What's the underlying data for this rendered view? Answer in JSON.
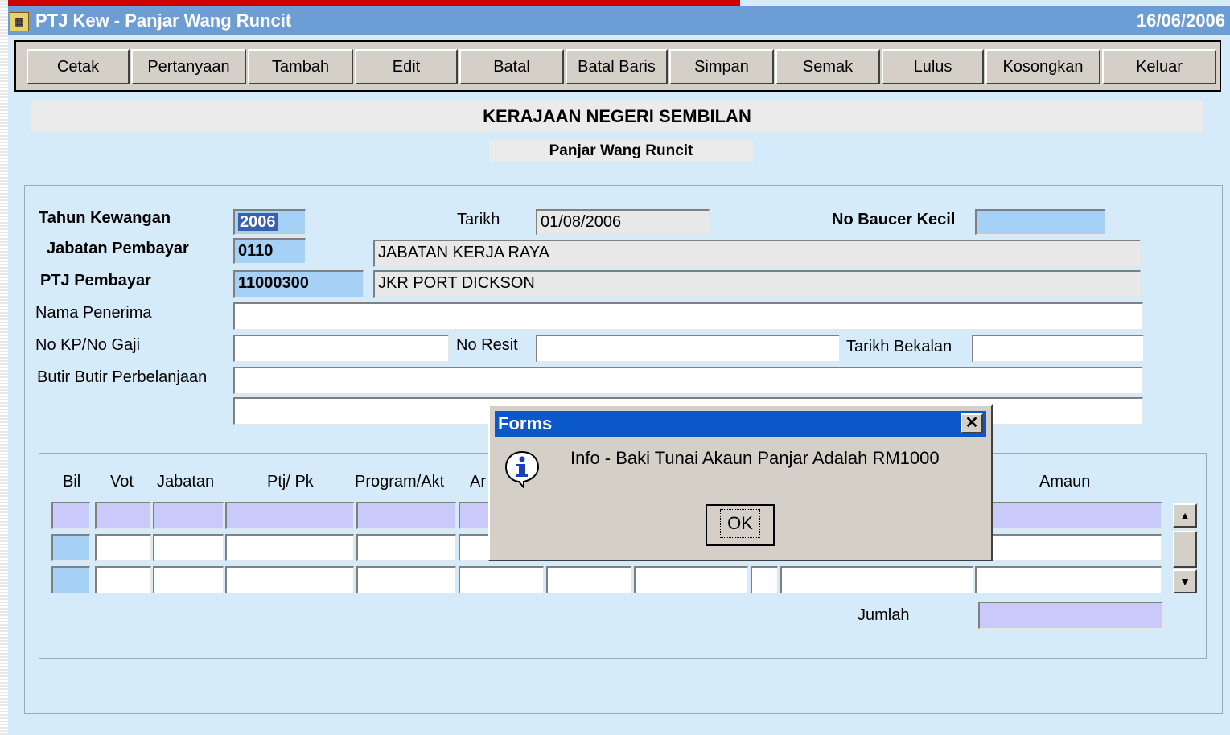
{
  "window": {
    "title": "PTJ Kew - Panjar Wang Runcit",
    "date": "16/06/2006"
  },
  "toolbar": {
    "buttons": [
      "Cetak",
      "Pertanyaan",
      "Tambah",
      "Edit",
      "Batal",
      "Batal Baris",
      "Simpan",
      "Semak",
      "Lulus",
      "Kosongkan",
      "Keluar"
    ]
  },
  "header": {
    "org": "KERAJAAN NEGERI SEMBILAN",
    "form": "Panjar Wang Runcit"
  },
  "form": {
    "tahun_label": "Tahun Kewangan",
    "tahun_value": "2006",
    "tarikh_label": "Tarikh",
    "tarikh_value": "01/08/2006",
    "baucer_label": "No Baucer Kecil",
    "baucer_value": "",
    "jabatan_label": "Jabatan Pembayar",
    "jabatan_code": "0110",
    "jabatan_name": "JABATAN KERJA RAYA",
    "ptj_label": "PTJ Pembayar",
    "ptj_code": "11000300",
    "ptj_name": "JKR PORT DICKSON",
    "penerima_label": "Nama Penerima",
    "penerima_value": "",
    "kp_label": "No KP/No Gaji",
    "kp_value": "",
    "resit_label": "No Resit",
    "resit_value": "",
    "bekalan_label": "Tarikh Bekalan",
    "bekalan_value": "",
    "butir_label": "Butir Butir Perbelanjaan",
    "butir_value1": "",
    "butir_value2": ""
  },
  "grid": {
    "columns": {
      "bil": "Bil",
      "vot": "Vot",
      "jabatan": "Jabatan",
      "ptj": "Ptj/ Pk",
      "program": "Program/Akt",
      "amanah_partial": "Ar",
      "amaun": "Amaun"
    },
    "jumlah_label": "Jumlah",
    "jumlah_value": ""
  },
  "dialog": {
    "title": "Forms",
    "message": "Info - Baki Tunai Akaun Panjar Adalah RM1000",
    "ok_label": "OK",
    "close_glyph": "✕"
  },
  "scroll": {
    "up": "▲",
    "down": "▼"
  },
  "icons": {
    "app": "forms-app-icon",
    "info": "info-icon"
  },
  "colors": {
    "title_bar": "#6c9dd4",
    "dialog_title": "#0a58c9",
    "background": "#d6ebf9",
    "highlight_field": "#a6d0f5",
    "grid_row": "#c9c9fa"
  }
}
